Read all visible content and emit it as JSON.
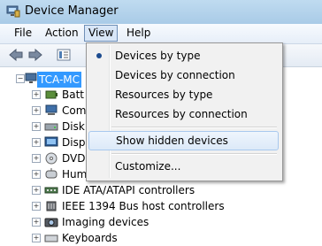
{
  "window": {
    "title": "Device Manager",
    "icon": "device-manager-icon"
  },
  "menubar": {
    "file": "File",
    "action": "Action",
    "view": "View",
    "help": "Help"
  },
  "toolbar": {
    "buttons": [
      "back-arrow-icon",
      "forward-arrow-icon",
      "properties-icon"
    ]
  },
  "view_menu": {
    "items": [
      {
        "label": "Devices by type",
        "checked": true
      },
      {
        "label": "Devices by connection"
      },
      {
        "label": "Resources by type"
      },
      {
        "label": "Resources by connection"
      },
      {
        "label": "Show hidden devices",
        "highlighted": true
      },
      {
        "label": "Customize..."
      }
    ]
  },
  "tree": {
    "root": "TCA-MC",
    "items": [
      {
        "label": "Batt",
        "icon": "battery-icon"
      },
      {
        "label": "Com",
        "icon": "computer-icon"
      },
      {
        "label": "Disk",
        "icon": "disk-drive-icon"
      },
      {
        "label": "Disp",
        "icon": "display-adapter-icon"
      },
      {
        "label": "DVD",
        "icon": "dvd-drive-icon"
      },
      {
        "label": "Hum",
        "icon": "human-interface-icon"
      },
      {
        "label": "IDE ATA/ATAPI controllers",
        "icon": "ide-controller-icon"
      },
      {
        "label": "IEEE 1394 Bus host controllers",
        "icon": "ieee1394-icon"
      },
      {
        "label": "Imaging devices",
        "icon": "imaging-device-icon"
      },
      {
        "label": "Keyboards",
        "icon": "keyboard-icon"
      }
    ]
  }
}
